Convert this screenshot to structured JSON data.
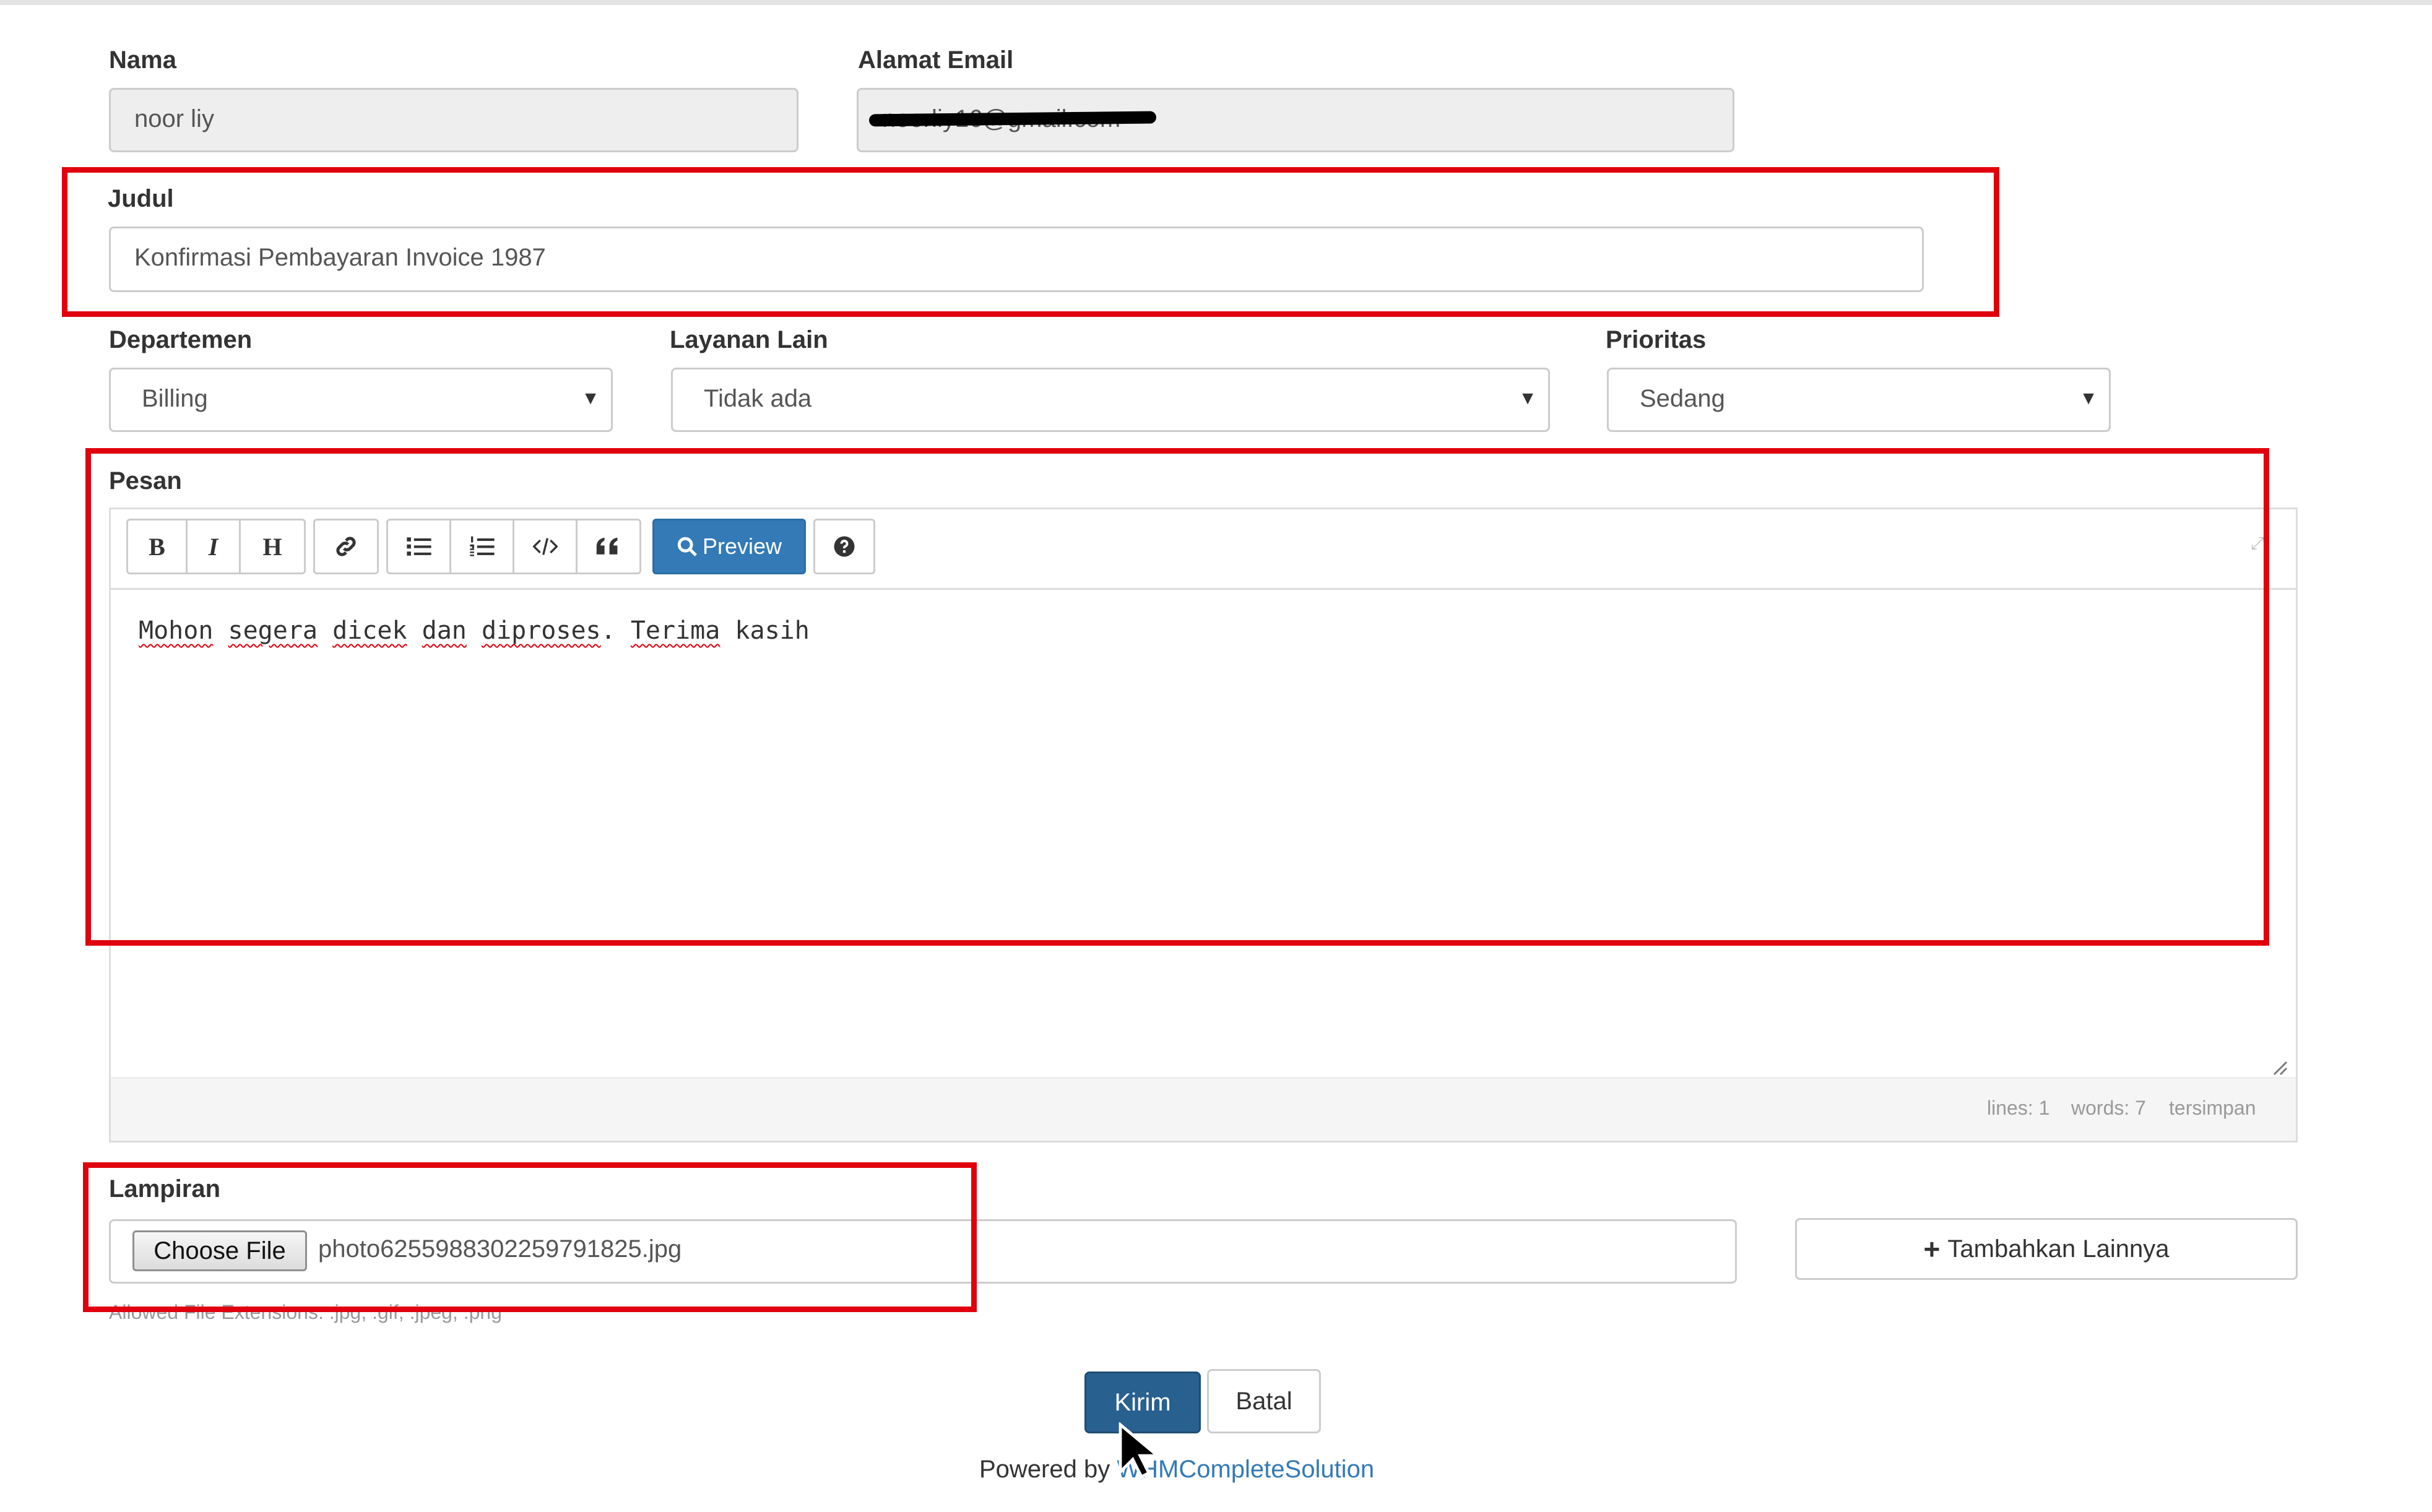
{
  "form": {
    "name": {
      "label": "Nama",
      "value": "noor liy"
    },
    "email": {
      "label": "Alamat Email",
      "value": "noorliy16@gmail.com"
    },
    "subject": {
      "label": "Judul",
      "value": "Konfirmasi Pembayaran Invoice 1987"
    },
    "department": {
      "label": "Departemen",
      "value": "Billing"
    },
    "related_service": {
      "label": "Layanan Lain",
      "value": "Tidak ada"
    },
    "priority": {
      "label": "Prioritas",
      "value": "Sedang"
    },
    "message": {
      "label": "Pesan",
      "toolbar": {
        "bold": "B",
        "italic": "I",
        "heading": "H",
        "link_icon": "link-icon",
        "unordered_list_icon": "list-ul-icon",
        "ordered_list_icon": "list-ol-icon",
        "code_icon": "code-icon",
        "quote_icon": "quote-icon",
        "preview_label": "Preview",
        "help_icon": "question-circle-icon"
      },
      "words": [
        "Mohon",
        "segera",
        "dicek",
        "dan",
        "diproses",
        ".",
        "Terima",
        "kasih"
      ],
      "status": {
        "lines": "lines: 1",
        "words": "words: 7",
        "saved": "tersimpan"
      }
    },
    "attachments": {
      "label": "Lampiran",
      "choose_file_label": "Choose File",
      "file_name": "photo6255988302259791825.jpg",
      "add_more_label": "Tambahkan Lainnya",
      "allowed_extensions": "Allowed File Extensions: .jpg, .gif, .jpeg, .png"
    },
    "submit_label": "Kirim",
    "cancel_label": "Batal"
  },
  "footer": {
    "powered_by": "Powered by",
    "link_text": "WHMCompleteSolution"
  },
  "colors": {
    "highlight_red": "#e0000d",
    "primary": "#337ab7",
    "submit": "#286090"
  }
}
